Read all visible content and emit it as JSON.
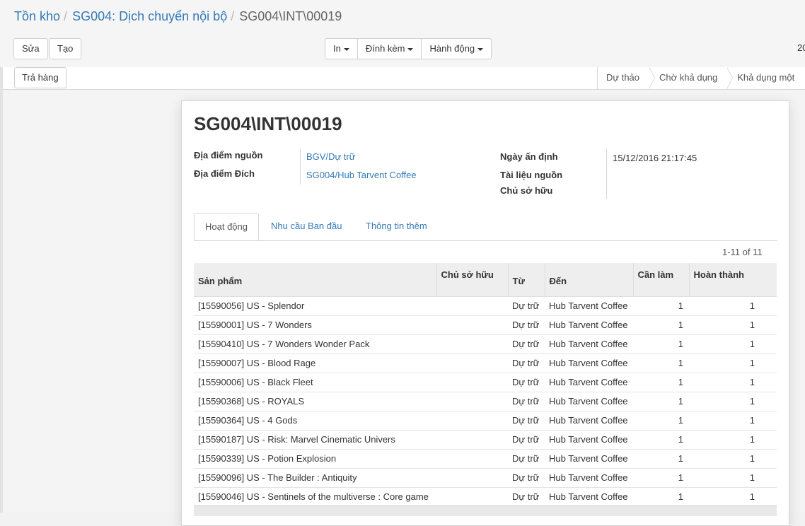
{
  "breadcrumb": {
    "root": "Tồn kho",
    "parent": "SG004: Dịch chuyển nội bộ",
    "current": "SG004\\INT\\00019"
  },
  "toolbar": {
    "edit_label": "Sửa",
    "create_label": "Tạo",
    "print_label": "In",
    "attach_label": "Đính kèm",
    "action_label": "Hành động",
    "pager_fragment": "20"
  },
  "statusbar": {
    "return_label": "Trả hàng",
    "stages": [
      "Dự thảo",
      "Chờ khả dụng",
      "Khả dụng một"
    ]
  },
  "record": {
    "name": "SG004\\INT\\00019",
    "fields_left": [
      {
        "label": "Địa điểm nguồn",
        "value": "BGV/Dự trữ"
      },
      {
        "label": "Địa điểm Đích",
        "value": "SG004/Hub Tarvent Coffee"
      }
    ],
    "fields_right": [
      {
        "label": "Ngày ấn định",
        "value": "15/12/2016 21:17:45"
      },
      {
        "label": "Tài liệu nguồn",
        "value": ""
      },
      {
        "label": "Chủ sở hữu",
        "value": ""
      }
    ]
  },
  "tabs": [
    "Hoạt động",
    "Nhu cầu Ban đầu",
    "Thông tin thêm"
  ],
  "list": {
    "pager": "1-11 of 11",
    "columns": [
      "Sản phẩm",
      "Chủ sở hữu",
      "Từ",
      "Đến",
      "Cần làm",
      "Hoàn thành"
    ],
    "rows": [
      [
        "[15590056] US - Splendor",
        "",
        "Dự trữ",
        "Hub Tarvent Coffee",
        "1",
        "1"
      ],
      [
        "[15590001] US - 7 Wonders",
        "",
        "Dự trữ",
        "Hub Tarvent Coffee",
        "1",
        "1"
      ],
      [
        "[15590410] US - 7 Wonders Wonder Pack",
        "",
        "Dự trữ",
        "Hub Tarvent Coffee",
        "1",
        "1"
      ],
      [
        "[15590007] US - Blood Rage",
        "",
        "Dự trữ",
        "Hub Tarvent Coffee",
        "1",
        "1"
      ],
      [
        "[15590006] US - Black Fleet",
        "",
        "Dự trữ",
        "Hub Tarvent Coffee",
        "1",
        "1"
      ],
      [
        "[15590368] US - ROYALS",
        "",
        "Dự trữ",
        "Hub Tarvent Coffee",
        "1",
        "1"
      ],
      [
        "[15590364] US - 4 Gods",
        "",
        "Dự trữ",
        "Hub Tarvent Coffee",
        "1",
        "1"
      ],
      [
        "[15590187] US - Risk: Marvel Cinematic Univers",
        "",
        "Dự trữ",
        "Hub Tarvent Coffee",
        "1",
        "1"
      ],
      [
        "[15590339] US - Potion Explosion",
        "",
        "Dự trữ",
        "Hub Tarvent Coffee",
        "1",
        "1"
      ],
      [
        "[15590096] US - The Builder : Antiquity",
        "",
        "Dự trữ",
        "Hub Tarvent Coffee",
        "1",
        "1"
      ],
      [
        "[15590046] US - Sentinels of the multiverse : Core game",
        "",
        "Dự trữ",
        "Hub Tarvent Coffee",
        "1",
        "1"
      ]
    ]
  },
  "colors": {
    "link": "#337ab7",
    "background": "#f2f2f2",
    "border": "#d6d6d6"
  }
}
